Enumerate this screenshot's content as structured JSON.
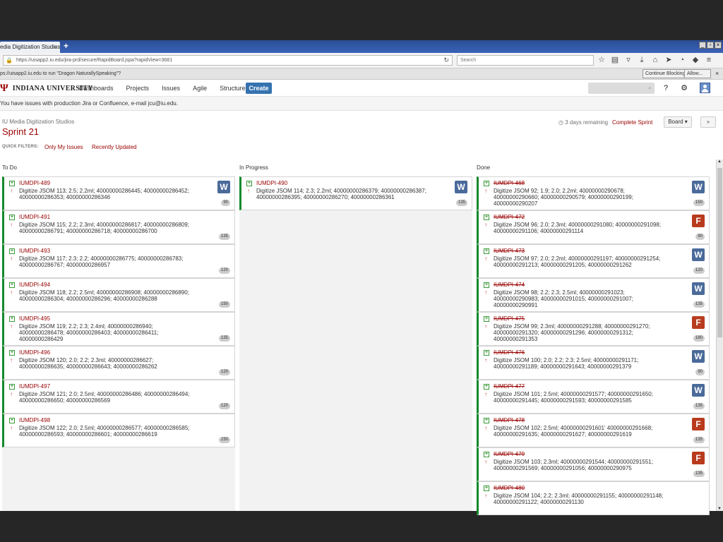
{
  "browser": {
    "tab_title": "edia Digitization Studios -...",
    "tab_close": "×",
    "new_tab": "+",
    "url": "https://uisapp2.iu.edu/jira-prd/secure/RapidBoard.jspa?rapidView=3681",
    "search_placeholder": "Search",
    "notification": "ps://uisapp2.iu.edu to run \"Dragon NaturallySpeaking\"?",
    "continue_blocking": "Continue Blocking",
    "allow": "Allow...",
    "notif_close": "×"
  },
  "jira": {
    "logo_name": "INDIANA UNIVERSITY",
    "menu": [
      "Dashboards",
      "Projects",
      "Issues",
      "Agile",
      "Structure"
    ],
    "create": "Create",
    "banner": "You have issues with production Jira or Confluence, e-mail jcu@iu.edu."
  },
  "board": {
    "project": "IU Media Digitization Studios",
    "sprint": "Sprint 21",
    "quick_filters_label": "QUICK FILTERS:",
    "filter_1": "Only My Issues",
    "filter_2": "Recently Updated",
    "remaining": "3 days remaining",
    "complete_sprint": "Complete Sprint",
    "board_button": "Board ▾",
    "collapse_button": "»"
  },
  "columns": [
    {
      "title": "To Do",
      "cards": [
        {
          "key": "IUMDPI-489",
          "summary": "Digitize JSOM 113; 2.5; 2.2ml; 40000000286445; 40000000286452; 40000000286353; 40000000286346",
          "est": "90",
          "app": "W",
          "done": false
        },
        {
          "key": "IUMDPI-491",
          "summary": "Digitize JSOM 115; 2.2; 2.3ml; 40000000286817; 40000000286809; 40000000286791; 40000000286718; 40000000286700",
          "est": "135",
          "app": "",
          "done": false
        },
        {
          "key": "IUMDPI-493",
          "summary": "Digitize JSOM 117; 2.3; 2.2; 40000000286775; 40000000286783; 40000000286767; 40000000286957",
          "est": "120",
          "app": "",
          "done": false
        },
        {
          "key": "IUMDPI-494",
          "summary": "Digitize JSOM 118; 2.2; 2.5ml; 40000000286908; 40000000286890; 40000000286304; 40000000286296; 40000000286288",
          "est": "150",
          "app": "",
          "done": false
        },
        {
          "key": "IUMDPI-495",
          "summary": "Digitize JSOM 119; 2.2; 2.3; 2.4ml; 40000000286940; 40000000286478; 40000000286403; 40000000286411; 40000000286429",
          "est": "135",
          "app": "",
          "done": false
        },
        {
          "key": "IUMDPI-496",
          "summary": "Digitize JSOM 120; 2.0; 2.2; 2.3ml; 40000000286627; 40000000286635; 40000000286643; 40000000286262",
          "est": "120",
          "app": "",
          "done": false
        },
        {
          "key": "IUMDPI-497",
          "summary": "Digitize JSOM 121; 2.0; 2.5ml; 40000000286486; 40000000286494; 40000000286650; 40000000286569",
          "est": "120",
          "app": "",
          "done": false
        },
        {
          "key": "IUMDPI-498",
          "summary": "Digitize JSOM 122; 2.0; 2.5ml; 40000000286577; 40000000286585; 40000000286593; 40000000286601; 40000000286619",
          "est": "150",
          "app": "",
          "done": false
        }
      ]
    },
    {
      "title": "In Progress",
      "cards": [
        {
          "key": "IUMDPI-490",
          "summary": "Digitize JSOM 114; 2.3; 2.2ml; 40000000286379; 40000000286387; 40000000286395; 40000000286270; 40000000286361",
          "est": "135",
          "app": "W",
          "done": false
        }
      ]
    },
    {
      "title": "Done",
      "cards": [
        {
          "key": "IUMDPI-468",
          "summary": "Digitize JSOM 92; 1.9; 2.0; 2.2ml; 40000000290678; 40000000290660; 40000000290579; 40000000290199; 40000000290207",
          "est": "150",
          "app": "W",
          "done": true
        },
        {
          "key": "IUMDPI-472",
          "summary": "Digitize JSOM 96; 2.0; 2.3ml; 40000000291080; 40000000291098; 40000000291106; 40000000291114",
          "est": "90",
          "app": "F",
          "done": true
        },
        {
          "key": "IUMDPI-473",
          "summary": "Digitize JSOM 97; 2.0; 2.2ml; 40000000291197; 40000000291254; 40000000291213; 40000000291205; 40000000291262",
          "est": "120",
          "app": "W",
          "done": true
        },
        {
          "key": "IUMDPI-474",
          "summary": "Digitize JSOM 98; 2.2; 2.3; 2.5ml; 40000000291023; 40000000290983; 40000000291015; 40000000291007; 40000000290991",
          "est": "135",
          "app": "W",
          "done": true
        },
        {
          "key": "IUMDPI-475",
          "summary": "Digitize JSOM 99; 2.3ml; 40000000291288; 40000000291270; 40000000291320; 40000000291296; 40000000291312; 40000000291353",
          "est": "180",
          "app": "F",
          "done": true
        },
        {
          "key": "IUMDPI-476",
          "summary": "Digitize JSOM 100; 2.0; 2.2; 2.3; 2.5ml; 40000000291171; 40000000291189; 40000000291643; 40000000291379",
          "est": "90",
          "app": "W",
          "done": true
        },
        {
          "key": "IUMDPI-477",
          "summary": "Digitize JSOM 101; 2.5ml; 40000000291577; 40000000291650; 40000000291445; 40000000291593; 40000000291585",
          "est": "135",
          "app": "W",
          "done": true
        },
        {
          "key": "IUMDPI-478",
          "summary": "Digitize JSOM 102; 2.5ml; 40000000291601' 40000000291668; 40000000291635; 40000000291627; 40000000291619",
          "est": "135",
          "app": "F",
          "done": true
        },
        {
          "key": "IUMDPI-479",
          "summary": "Digitize JSOM 103; 2.3ml; 40000000291544; 40000000291551; 40000000291569; 40000000291056; 40000000290975",
          "est": "135",
          "app": "F",
          "done": true
        },
        {
          "key": "IUMDPI-480",
          "summary": "Digitize JSOM 104; 2.2; 2.3ml; 40000000291155; 40000000291148; 40000000291122; 40000000291130",
          "est": "",
          "app": "",
          "done": true
        }
      ]
    }
  ]
}
